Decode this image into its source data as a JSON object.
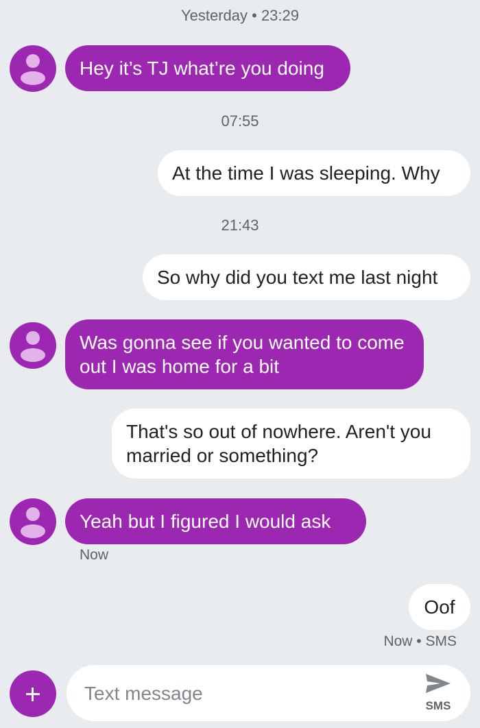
{
  "conversation": {
    "timestamps": [
      "Yesterday • 23:29",
      "07:55",
      "21:43"
    ],
    "messages": [
      {
        "direction": "incoming",
        "text": "Hey it’s TJ what’re you doing"
      },
      {
        "direction": "outgoing",
        "text": "At the time I was sleeping. Why"
      },
      {
        "direction": "outgoing",
        "text": "So why did you text me last night"
      },
      {
        "direction": "incoming",
        "text": "Was gonna see if you wanted to come out I was home for a bit"
      },
      {
        "direction": "outgoing",
        "text": "That's so out of nowhere. Aren't you married or something?"
      },
      {
        "direction": "incoming",
        "text": "Yeah but I figured I would ask",
        "status": "Now"
      },
      {
        "direction": "outgoing",
        "text": "Oof",
        "status": "Now • SMS"
      }
    ]
  },
  "composer": {
    "placeholder": "Text message",
    "value": "",
    "send_label": "SMS",
    "add_icon": "plus-icon",
    "send_icon": "send-icon"
  },
  "colors": {
    "background": "#e8ecef",
    "incoming_bubble": "#9c27b0",
    "outgoing_bubble": "#ffffff",
    "accent": "#9c27b0"
  }
}
